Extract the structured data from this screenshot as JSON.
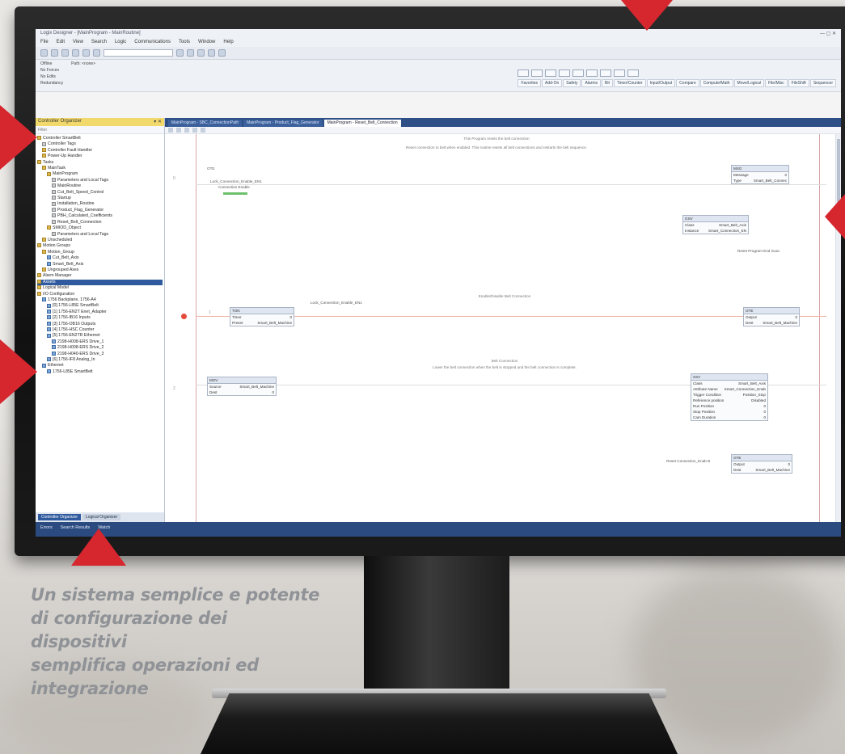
{
  "caption": {
    "lines": [
      "Un sistema semplice e potente",
      "di configurazione dei dispositivi",
      "semplifica operazioni ed",
      "integrazione"
    ]
  },
  "colors": {
    "accent_red": "#d6262e",
    "caption_gray": "#8f9296",
    "ide_blue": "#2d4f86",
    "organizer_header": "#f2d96b"
  },
  "app": {
    "title": "Logix Designer - [MainProgram - MainRoutine]",
    "menu": [
      "File",
      "Edit",
      "View",
      "Search",
      "Logic",
      "Communications",
      "Tools",
      "Window",
      "Help"
    ],
    "status_band": {
      "left": [
        "Offline",
        "No Forces",
        "No Edits",
        "Redundancy"
      ],
      "path": "Path: <none>"
    },
    "element_tabs": [
      "Favorites",
      "Add-On",
      "Safety",
      "Alarms",
      "Bit",
      "Timer/Counter",
      "Input/Output",
      "Compare",
      "Compute/Math",
      "Move/Logical",
      "File/Misc",
      "FileShift",
      "Sequencer"
    ]
  },
  "organizer": {
    "header": "Controller Organizer",
    "filter": "Filter",
    "tree": [
      {
        "label": "Controller SmartBelt",
        "icon": "folder-icon",
        "indent": 0
      },
      {
        "label": "Controller Tags",
        "icon": "tag-icon",
        "indent": 1
      },
      {
        "label": "Controller Fault Handler",
        "icon": "folder-icon",
        "indent": 1
      },
      {
        "label": "Power-Up Handler",
        "icon": "folder-icon",
        "indent": 1
      },
      {
        "label": "Tasks",
        "icon": "folder-icon",
        "indent": 0
      },
      {
        "label": "MainTask",
        "icon": "task-icon",
        "indent": 1
      },
      {
        "label": "MainProgram",
        "icon": "folder-icon",
        "indent": 2
      },
      {
        "label": "Parameters and Local Tags",
        "icon": "tag-icon",
        "indent": 3
      },
      {
        "label": "MainRoutine",
        "icon": "routine-icon",
        "indent": 3
      },
      {
        "label": "Cut_Belt_Speed_Control",
        "icon": "routine-icon",
        "indent": 3
      },
      {
        "label": "Startup",
        "icon": "routine-icon",
        "indent": 3
      },
      {
        "label": "Installation_Routine",
        "icon": "routine-icon",
        "indent": 3
      },
      {
        "label": "Product_Flag_Generator",
        "icon": "routine-icon",
        "indent": 3
      },
      {
        "label": "PBH_Calculated_Coefficients",
        "icon": "routine-icon",
        "indent": 3
      },
      {
        "label": "Reset_Belt_Connection",
        "icon": "routine-icon",
        "indent": 3
      },
      {
        "label": "SMIOD_Object",
        "icon": "folder-icon",
        "indent": 2
      },
      {
        "label": "Parameters and Local Tags",
        "icon": "tag-icon",
        "indent": 3
      },
      {
        "label": "Unscheduled",
        "icon": "folder-icon",
        "indent": 1
      },
      {
        "label": "Motion Groups",
        "icon": "folder-icon",
        "indent": 0
      },
      {
        "label": "Motion_Group",
        "icon": "folder-icon",
        "indent": 1
      },
      {
        "label": "Cut_Belt_Axis",
        "icon": "axis-icon",
        "indent": 2
      },
      {
        "label": "Smart_Belt_Axis",
        "icon": "axis-icon",
        "indent": 2
      },
      {
        "label": "Ungrouped Axes",
        "icon": "folder-icon",
        "indent": 1
      },
      {
        "label": "Alarm Manager",
        "icon": "folder-icon",
        "indent": 0
      },
      {
        "label": "Assets",
        "icon": "folder-icon",
        "indent": 0,
        "selected": true
      },
      {
        "label": "Logical Model",
        "icon": "folder-icon",
        "indent": 0
      },
      {
        "label": "I/O Configuration",
        "icon": "folder-icon",
        "indent": 0
      },
      {
        "label": "1756 Backplane, 1756-A4",
        "icon": "backplane-icon",
        "indent": 1
      },
      {
        "label": "[0] 1756-L85E SmartBelt",
        "icon": "module-icon",
        "indent": 2
      },
      {
        "label": "[1] 1756-EN2T Enet_Adapter",
        "icon": "module-icon",
        "indent": 2
      },
      {
        "label": "[2] 1756-IB16 Inputs",
        "icon": "module-icon",
        "indent": 2
      },
      {
        "label": "[3] 1756-OB16 Outputs",
        "icon": "module-icon",
        "indent": 2
      },
      {
        "label": "[4] 1756-HSC Counter",
        "icon": "module-icon",
        "indent": 2
      },
      {
        "label": "[5] 1756-EN2TR Ethernet",
        "icon": "module-icon",
        "indent": 2
      },
      {
        "label": "2198-H008-ERS Drive_1",
        "icon": "drive-icon",
        "indent": 3
      },
      {
        "label": "2198-H008-ERS Drive_2",
        "icon": "drive-icon",
        "indent": 3
      },
      {
        "label": "2198-H040-ERS Drive_3",
        "icon": "drive-icon",
        "indent": 3
      },
      {
        "label": "[6] 1756-IF8 Analog_In",
        "icon": "module-icon",
        "indent": 2
      },
      {
        "label": "Ethernet",
        "icon": "network-icon",
        "indent": 1
      },
      {
        "label": "1756-L85E SmartBelt",
        "icon": "module-icon",
        "indent": 2
      }
    ],
    "tabs": [
      "Controller Organizer",
      "Logical Organizer"
    ]
  },
  "editor": {
    "doc_tabs": [
      "MainProgram - SBC_ConnectionPath",
      "MainProgram - Product_Flag_Generator",
      "MainProgram - Reset_Belt_Connection"
    ],
    "active_tab_index": 2,
    "rung0": {
      "header": "This Program resets the belt connection",
      "comment": "Reset connection to belt when enabled. This routine resets all belt connections and restarts the belt sequence.",
      "xic_tag": "Lock_Connection_Enable_EN1",
      "xic_desc": "Connection Enable",
      "ons_label": "OTE",
      "box1": {
        "title": "MSG",
        "rows": [
          [
            "Message",
            "0"
          ],
          [
            "Type",
            "Smart_Belt_Connec"
          ]
        ]
      },
      "box2": {
        "title": "GSV",
        "rows": [
          [
            "Class",
            "Smart_Belt_Axis"
          ],
          [
            "Instance",
            "Smart_Connection_EN"
          ]
        ]
      },
      "output": "Reset Program End Scan"
    },
    "rung1": {
      "comment": "Enable/Disable Belt Connection",
      "xic_tag": "Lock_Connection_Enable_EN1",
      "left_box": {
        "title": "TON",
        "rows": [
          [
            "Timer",
            "0"
          ],
          [
            "Preset",
            "Smart_Belt_Machine"
          ]
        ]
      },
      "right_box": {
        "title": "OTE",
        "rows": [
          [
            "Output",
            "0"
          ],
          [
            "Dest",
            "Smart_Belt_Machine"
          ]
        ]
      }
    },
    "rung2": {
      "header": "Belt Connection",
      "comment": "Lower the belt connection when the belt is stopped and the belt connection is complete.",
      "left_box": {
        "title": "MOV",
        "rows": [
          [
            "Source",
            "Smart_Belt_Machine"
          ],
          [
            "Dest",
            "0"
          ]
        ]
      },
      "big_box": {
        "title": "SSV",
        "rows": [
          [
            "Class",
            "Smart_Belt_Axis"
          ],
          [
            "Attribute Name",
            "Smart_Connection_Enab"
          ],
          [
            "Trigger Condition",
            "Position_Stop"
          ],
          [
            "Reference position",
            "Disabled"
          ],
          [
            "Run Position",
            "0"
          ],
          [
            "Stop Position",
            "0"
          ],
          [
            "Cam Duration",
            "0"
          ]
        ]
      },
      "output_tag": "Reset Connection_Enab B",
      "out_box": {
        "title": "OTE",
        "rows": [
          [
            "Output",
            "0"
          ],
          [
            "Dest",
            "Smart_Belt_Machine"
          ]
        ]
      }
    }
  },
  "status_bar": [
    "Errors",
    "Search Results",
    "Watch"
  ]
}
